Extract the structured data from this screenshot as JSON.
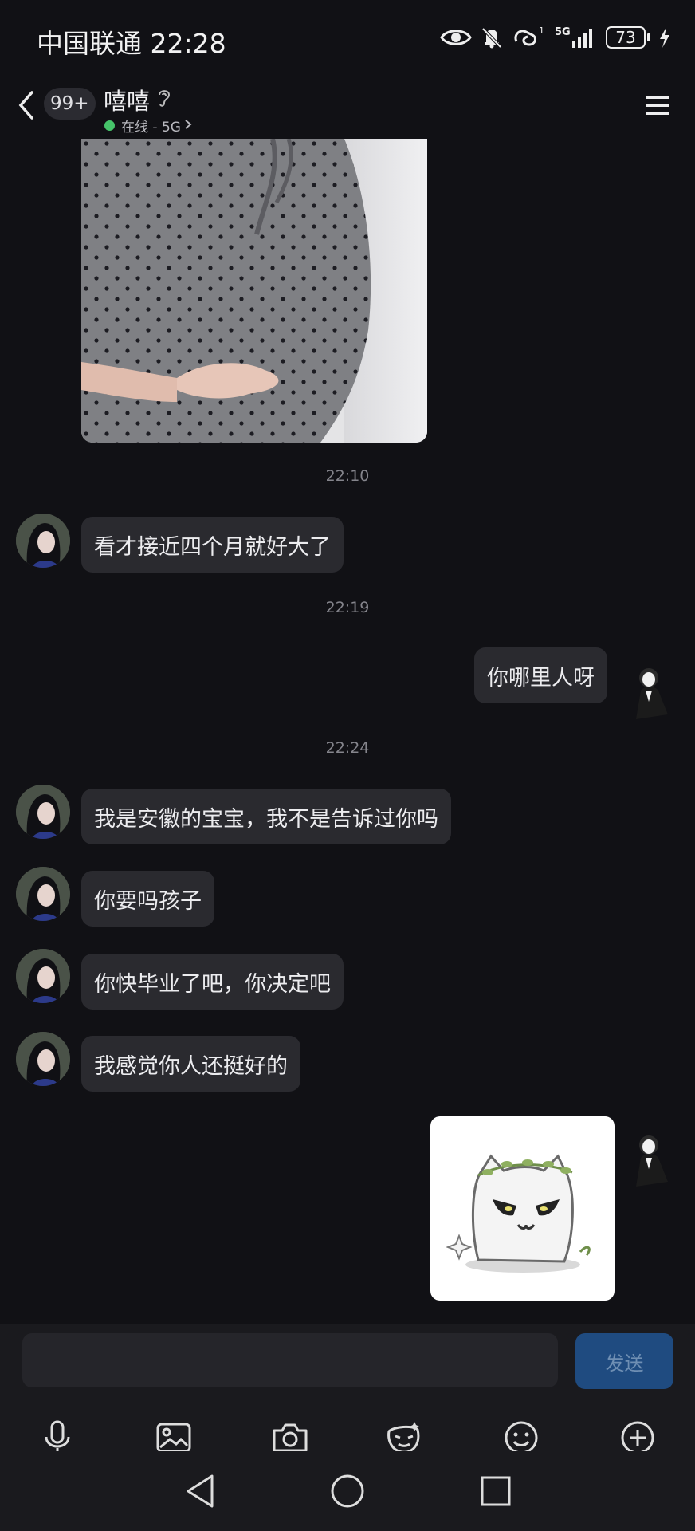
{
  "status_bar": {
    "carrier_time": "中国联通 22:28",
    "signal_label": "5G",
    "sim_index": "1",
    "battery": "73",
    "icons": [
      "eye-icon",
      "bell-off-icon",
      "hd-call-icon",
      "signal-icon",
      "battery-icon",
      "charging-icon"
    ]
  },
  "header": {
    "unread_count": "99+",
    "contact_name": "嘻嘻",
    "status_text": "在线 - 5G",
    "icons": [
      "back-icon",
      "ear-icon",
      "menu-icon"
    ]
  },
  "messages": [
    {
      "type": "image",
      "side": "left",
      "desc_icon": "photo-message"
    },
    {
      "type": "time",
      "text": "22:10"
    },
    {
      "type": "text",
      "side": "left",
      "text": "看才接近四个月就好大了"
    },
    {
      "type": "time",
      "text": "22:19"
    },
    {
      "type": "text",
      "side": "right",
      "text": "你哪里人呀"
    },
    {
      "type": "time",
      "text": "22:24"
    },
    {
      "type": "text",
      "side": "left",
      "text": "我是安徽的宝宝，我不是告诉过你吗"
    },
    {
      "type": "text",
      "side": "left",
      "text": "你要吗孩子"
    },
    {
      "type": "text",
      "side": "left",
      "text": "你快毕业了吧，你决定吧"
    },
    {
      "type": "text",
      "side": "left",
      "text": "我感觉你人还挺好的"
    },
    {
      "type": "sticker",
      "side": "right",
      "desc_icon": "cat-sticker"
    }
  ],
  "input": {
    "value": "",
    "send_label": "发送"
  },
  "toolbar": {
    "items": [
      "microphone-icon",
      "gallery-icon",
      "camera-icon",
      "sticker-icon",
      "emoji-icon",
      "plus-icon"
    ]
  },
  "nav": {
    "items": [
      "back-nav-icon",
      "home-nav-icon",
      "recents-nav-icon"
    ]
  },
  "colors": {
    "background": "#111115",
    "bubble": "#2a2a2f",
    "send_button": "#1f4b80",
    "online": "#46c46a"
  }
}
